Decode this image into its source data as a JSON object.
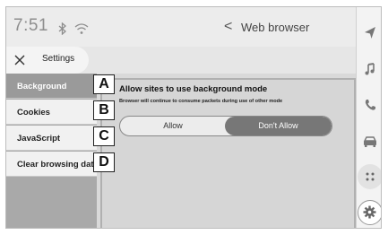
{
  "status_bar": {
    "time": "7:51",
    "bluetooth_icon": "bluetooth-icon",
    "wifi_icon": "wifi-icon",
    "back_glyph": "<",
    "title": "Web browser"
  },
  "settings_header": {
    "close_icon": "close-icon",
    "label": "Settings"
  },
  "sidebar": {
    "items": [
      {
        "label": "Background",
        "selected": true
      },
      {
        "label": "Cookies",
        "selected": false
      },
      {
        "label": "JavaScript",
        "selected": false
      },
      {
        "label": "Clear browsing data",
        "selected": false
      }
    ]
  },
  "callouts": [
    "A",
    "B",
    "C",
    "D"
  ],
  "panel": {
    "title": "Allow sites to use background mode",
    "description": "Browser will continue to consume packets during use of other mode",
    "options": {
      "allow": "Allow",
      "deny": "Don't Allow",
      "selected": "Don't Allow"
    }
  },
  "rail_icons": [
    "navigation-icon",
    "music-icon",
    "phone-icon",
    "car-icon",
    "apps-icon",
    "gear-icon"
  ],
  "colors": {
    "selected_sidebar": "#9a9a9a",
    "selected_option": "#777777",
    "panel_bg": "#d6d6d6"
  }
}
